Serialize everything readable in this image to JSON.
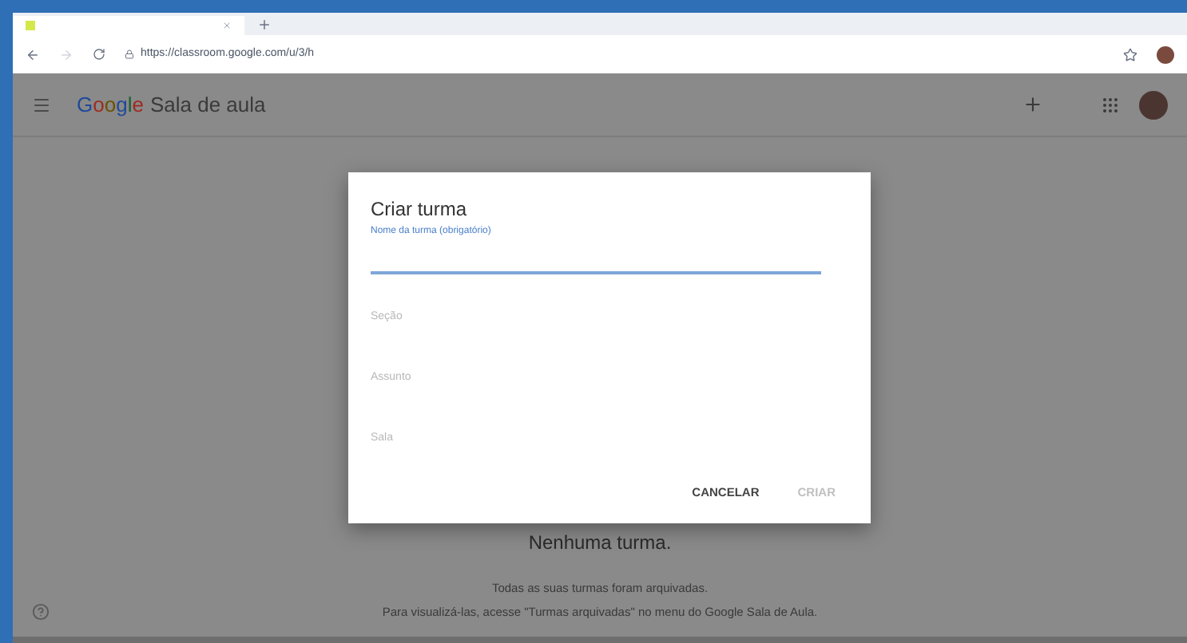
{
  "browser": {
    "url": "https://classroom.google.com/u/3/h"
  },
  "app_bar": {
    "logo": "Google",
    "title": "Sala de aula"
  },
  "empty_state": {
    "heading": "Nenhuma turma.",
    "lines": [
      "Todas as suas turmas foram arquivadas.",
      "Para visualizá-las, acesse \"Turmas arquivadas\" no menu do Google Sala de Aula."
    ]
  },
  "dialog": {
    "title": "Criar turma",
    "fields": [
      {
        "label": "Nome da turma (obrigatório)",
        "focused": true
      },
      {
        "placeholder": "Seção",
        "focused": false
      },
      {
        "placeholder": "Assunto",
        "focused": false
      },
      {
        "placeholder": "Sala",
        "focused": false
      }
    ],
    "buttons": [
      {
        "label": "CANCELAR",
        "disabled": false
      },
      {
        "label": "CRIAR",
        "disabled": true
      }
    ]
  }
}
